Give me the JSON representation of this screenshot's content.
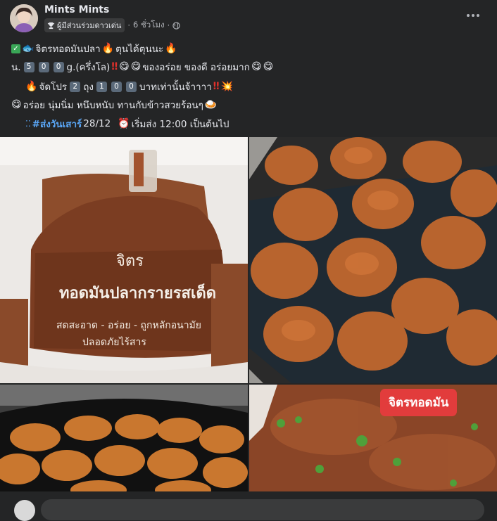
{
  "post": {
    "author": "Mints Mints",
    "badge_label": "ผู้มีส่วนร่วมดาวเด่น",
    "time": "6 ชั่วโมง",
    "separator": "·",
    "audience_icon": "globe-icon"
  },
  "lines": {
    "l1_text_a": "จิตรทอดมันปลา",
    "l1_text_b": "ตุนได้ตุนนะ",
    "l2_prefix": "น.",
    "l2_digits": [
      "5",
      "0",
      "0"
    ],
    "l2_text": "g.(ครึ่งโล)",
    "l2_text_b": "ของอร่อย ของดี  อร่อยมาก",
    "l3_text_a": "จัดโปร",
    "l3_digit": "2",
    "l3_text_b": "ถุง",
    "l3_digits": [
      "1",
      "0",
      "0"
    ],
    "l3_text_c": "บาทเท่านั้นจ้าาาา",
    "l4_text": "อร่อย นุ่มนิ่ม หนึบหนับ ทานกับข้าวสวยร้อนๆ",
    "l5_hashtag": "#ส่งวันเสาร์",
    "l5_date": "28/12",
    "l5_text": "เริ่มส่ง 12:00 เป็นต้นไป"
  },
  "photos": {
    "package_brand": "จิตร",
    "package_line1": "ทอดมันปลากรายรสเด็ด",
    "package_line2": "สดสะอาด - อร่อย - ถูกหลักอนามัย",
    "package_line3": "ปลอดภัยไร้สาร",
    "label_overlay": "จิตรทอดมัน"
  },
  "icons": {
    "check": "check-mark-icon",
    "fire": "fire-icon",
    "double_exclaim": "double-exclamation-icon",
    "smile": "smiling-face-icon",
    "boom": "collision-icon",
    "alarm": "alarm-clock-icon",
    "curry": "curry-plate-icon",
    "trophy": "trophy-icon",
    "more": "more-options-icon"
  },
  "colors": {
    "background": "#242526",
    "text": "#e4e6eb",
    "secondary_text": "#b0b3b8",
    "hashtag": "#5aa7f7",
    "label_red": "#e23c3c"
  }
}
